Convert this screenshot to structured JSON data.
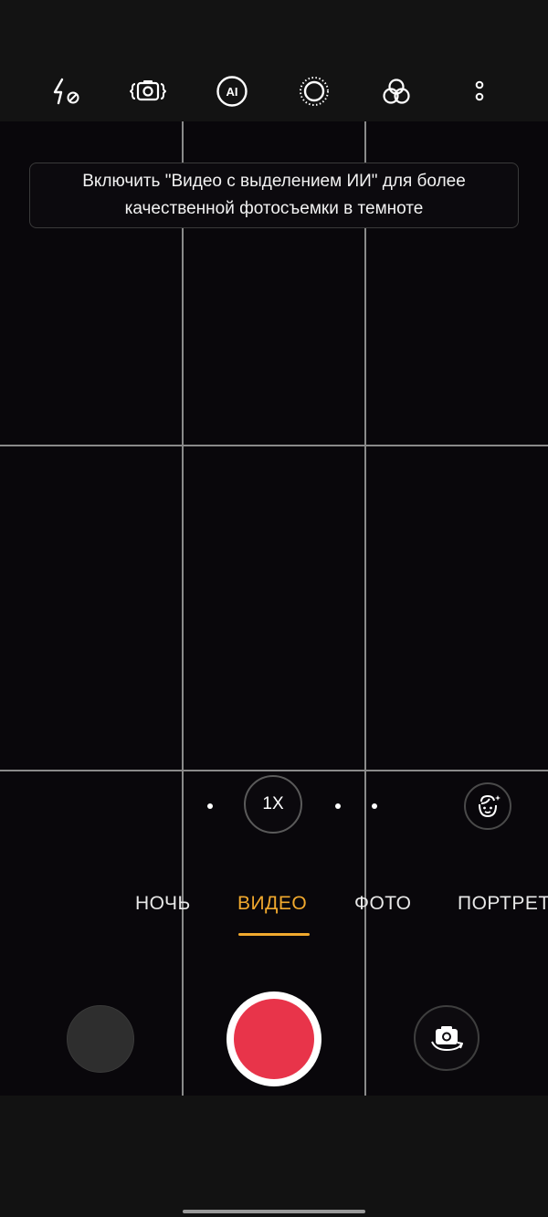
{
  "top_bar": {
    "icons": [
      "flash-off-icon",
      "camera-stabilize-icon",
      "ai-icon",
      "live-photo-icon",
      "filters-icon",
      "more-options-icon"
    ],
    "ai_label": "AI"
  },
  "tip": {
    "text": "Включить \"Видео с выделением ИИ\" для более качественной фотосъемки в темноте"
  },
  "zoom": {
    "current": "1X"
  },
  "modes": {
    "items": [
      "НОЧЬ",
      "ВИДЕО",
      "ФОТО",
      "ПОРТРЕТ"
    ],
    "active": "ВИДЕО"
  },
  "colors": {
    "accent": "#f1a92e",
    "record": "#e8344a",
    "background": "#09070b"
  }
}
